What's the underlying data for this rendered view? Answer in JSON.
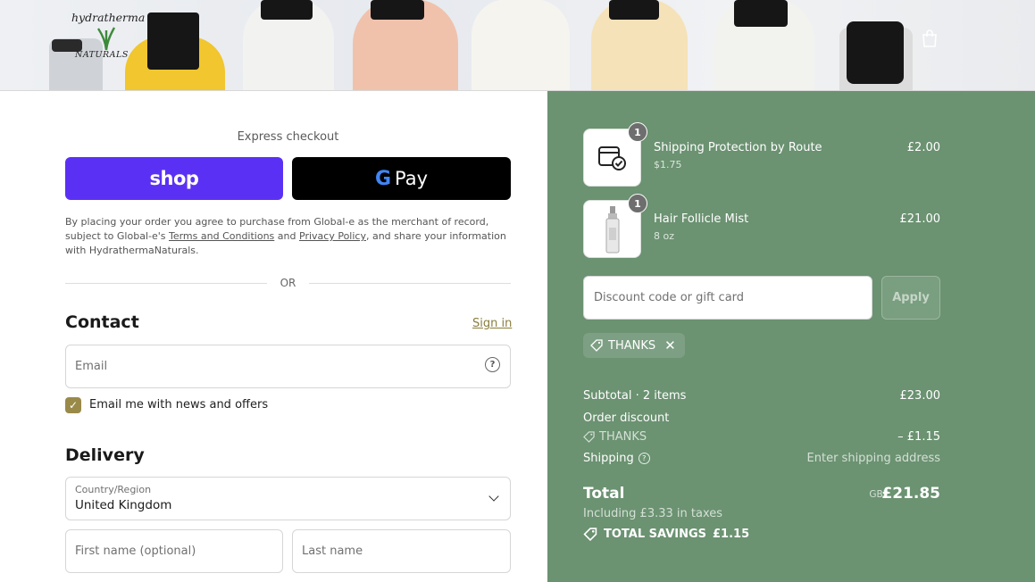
{
  "header": {
    "logo_line1": "hydratherma",
    "logo_line2": "NATURALS"
  },
  "express": {
    "title": "Express checkout",
    "shop_label": "shop",
    "gpay_label": "Pay",
    "gpay_g": "G"
  },
  "legal": {
    "pre": "By placing your order you agree to purchase from Global-e as the merchant of record, subject to Global-e's ",
    "terms": "Terms and Conditions",
    "and": " and ",
    "privacy": "Privacy Policy",
    "post": ", and share your information with HydrathermaNaturals."
  },
  "or_label": "OR",
  "contact": {
    "heading": "Contact",
    "sign_in": "Sign in",
    "email_placeholder": "Email",
    "newsletter_label": "Email me with news and offers",
    "newsletter_checked": true
  },
  "delivery": {
    "heading": "Delivery",
    "country_label": "Country/Region",
    "country_value": "United Kingdom",
    "first_name_placeholder": "First name (optional)",
    "last_name_placeholder": "Last name"
  },
  "cart": {
    "items": [
      {
        "name": "Shipping Protection by Route",
        "sub": "$1.75",
        "price": "£2.00",
        "qty": "1",
        "icon": "package-check-icon"
      },
      {
        "name": "Hair Follicle Mist",
        "sub": "8 oz",
        "price": "£21.00",
        "qty": "1",
        "icon": "spray-bottle-icon"
      }
    ],
    "discount_placeholder": "Discount code or gift card",
    "apply_label": "Apply",
    "applied_code": "THANKS",
    "subtotal_label": "Subtotal · 2 items",
    "subtotal_value": "£23.00",
    "order_discount_label": "Order discount",
    "discount_code": "THANKS",
    "discount_value": "– £1.15",
    "shipping_label": "Shipping",
    "shipping_value": "Enter shipping address",
    "total_label": "Total",
    "currency": "GBP",
    "total_value": "£21.85",
    "taxes_note": "Including £3.33 in taxes",
    "savings_label": "TOTAL SAVINGS",
    "savings_value": "£1.15"
  },
  "colors": {
    "shop_purple": "#5a31f4",
    "summary_green": "#6b9271",
    "link_gold": "#8a7d3c"
  }
}
